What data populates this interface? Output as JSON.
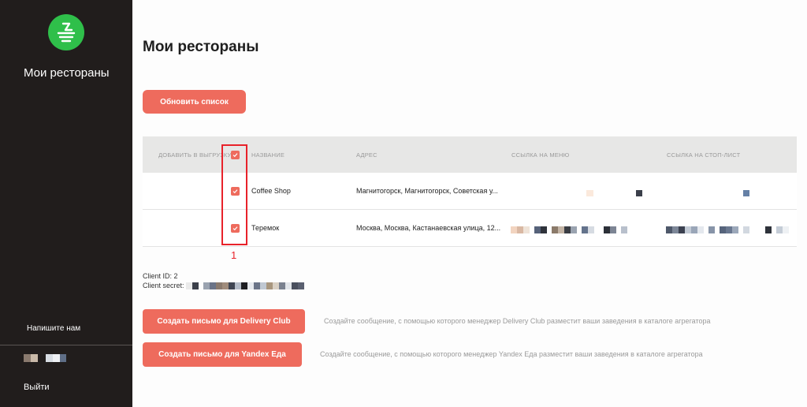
{
  "sidebar": {
    "logo_icon": "brand-logo-icon",
    "title": "Мои рестораны",
    "contact_label": "Напишите нам",
    "logout_label": "Выйти"
  },
  "main": {
    "title": "Мои рестораны",
    "refresh_label": "Обновить список",
    "table": {
      "columns": [
        "ДОБАВИТЬ В ВЫГРУЗКУ",
        "НАЗВАНИЕ",
        "АДРЕС",
        "ССЫЛКА НА МЕНЮ",
        "ССЫЛКА НА СТОП-ЛИСТ"
      ],
      "rows": [
        {
          "name": "Coffee Shop",
          "address": "Магнитогорск, Магнитогорск, Советская у..."
        },
        {
          "name": "Теремок",
          "address": "Москва, Москва, Кастанаевская улица, 12..."
        }
      ]
    },
    "highlight_marker": "1",
    "client_id": "Client ID: 2",
    "client_secret_label": "Client secret:",
    "delivery_club_button": "Создать письмо для Delivery Club",
    "delivery_club_desc": "Создайте сообщение, с помощью которого менеджер Delivery Club разместит ваши заведения в каталоге агрегатора",
    "yandex_button": "Создать письмо для Yandex Еда",
    "yandex_desc": "Создайте сообщение, с помощью которого менеджер Yandex Еда разместит ваши заведения в каталоге агрегатора"
  },
  "colors": {
    "accent": "#ee6b5d",
    "sidebar_bg": "#211d1c",
    "logo_green": "#2fbf4a",
    "highlight": "#e8222a"
  }
}
